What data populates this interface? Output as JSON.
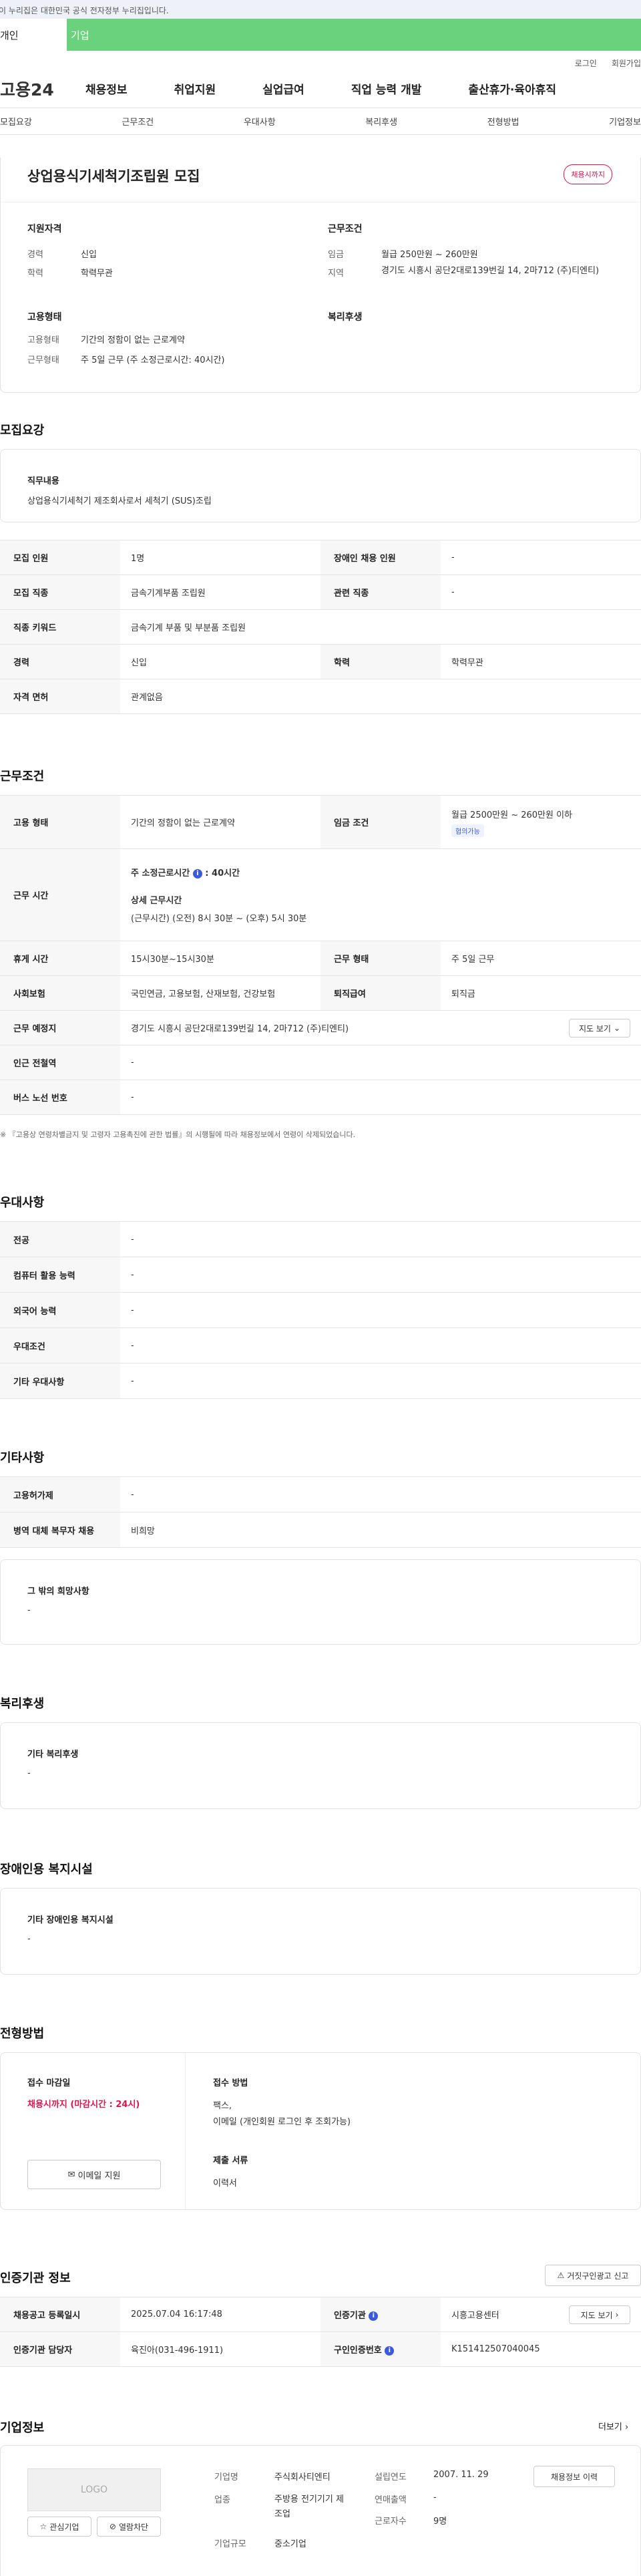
{
  "gov_banner": {
    "text": "이 누리집은 대한민국 공식 전자정부 누리집입니다."
  },
  "top_tabs": [
    {
      "label": "개인"
    },
    {
      "label": "기업"
    }
  ],
  "utility": {
    "login": "로그인",
    "join": "회원가입"
  },
  "gnb": {
    "logo": "고용24",
    "items": [
      "채용정보",
      "취업지원",
      "실업급여",
      "직업 능력 개발",
      "출산휴가·육아휴직"
    ]
  },
  "subnav": [
    "모집요강",
    "근무조건",
    "우대사항",
    "복리후생",
    "전형방법",
    "기업정보"
  ],
  "summary": {
    "title": "상업용식기세척기조립원 모집",
    "badge": "채용시까지",
    "qual_title": "지원자격",
    "career_label": "경력",
    "career_value": "신입",
    "edu_label": "학력",
    "edu_value": "학력무관",
    "cond_title": "근무조건",
    "wage_label": "임금",
    "wage_value": "월급 250만원 ~ 260만원",
    "area_label": "지역",
    "area_value": "경기도 시흥시 공단2대로139번길 14, 2마712 (주)티엔티)",
    "emp_title": "고용형태",
    "emptype_label": "고용형태",
    "emptype_value": "기간의 정함이 없는 근로계약",
    "worktype_label": "근무형태",
    "worktype_value": "주 5일 근무 (주 소정근로시간: 40시간)",
    "welfare_title": "복리후생"
  },
  "recruit": {
    "section_title": "모집요강",
    "duty_label": "직무내용",
    "duty_value": "상업용식기세척기 제조회사로서 세척기 (SUS)조립",
    "rows": {
      "headcount_h": "모집 인원",
      "headcount_v": "1명",
      "disabled_h": "장애인 채용 인원",
      "disabled_v": "-",
      "job_h": "모집 직종",
      "job_v": "금속기계부품 조립원",
      "related_h": "관련 직종",
      "related_v": "-",
      "keyword_h": "직종 키워드",
      "keyword_v": "금속기계 부품 및 부분품 조립원",
      "career_h": "경력",
      "career_v": "신입",
      "edu_h": "학력",
      "edu_v": "학력무관",
      "license_h": "자격 면허",
      "license_v": "관계없음"
    }
  },
  "work": {
    "section_title": "근무조건",
    "emp_h": "고용 형태",
    "emp_v": "기간의 정함이 없는 근로계약",
    "wage_h": "임금 조건",
    "wage_v": "월급 2500만원 ~ 260만원 이하",
    "wage_badge": "협의가능",
    "hours_h": "근무 시간",
    "hours_std_label": "주 소정근로시간",
    "hours_std_value": "40시간",
    "hours_detail_label": "상세 근무시간",
    "hours_detail_value": "(근무시간) (오전) 8시 30분 ~ (오후) 5시 30분",
    "rest_h": "휴게 시간",
    "rest_v": "15시30분~15시30분",
    "worktype_h": "근무 형태",
    "worktype_v": "주 5일 근무",
    "insurance_h": "사회보험",
    "insurance_v": "국민연금, 고용보험, 산재보험, 건강보험",
    "severance_h": "퇴직급여",
    "severance_v": "퇴직금",
    "place_h": "근무 예정지",
    "place_v": "경기도 시흥시 공단2대로139번길 14, 2마712 (주)티엔티)",
    "map_btn": "지도 보기",
    "station_h": "인근 전철역",
    "station_v": "-",
    "bus_h": "버스 노선 번호",
    "bus_v": "-",
    "note": "※ 『고용상 연령차별금지 및 고령자 고용촉진에 관한 법률』의 시행될에 따라 채용정보에서 연령이 삭제되었습니다."
  },
  "pref": {
    "section_title": "우대사항",
    "rows": [
      {
        "h": "전공",
        "v": "-"
      },
      {
        "h": "컴퓨터 활용 능력",
        "v": "-"
      },
      {
        "h": "외국어 능력",
        "v": "-"
      },
      {
        "h": "우대조건",
        "v": "-"
      },
      {
        "h": "기타 우대사항",
        "v": "-"
      }
    ]
  },
  "etc": {
    "section_title": "기타사항",
    "rows": [
      {
        "h": "고용허가제",
        "v": "-"
      },
      {
        "h": "병역 대체 복무자 채용",
        "v": "비희망"
      }
    ],
    "other_label": "그 밖의 희망사항",
    "other_value": "-"
  },
  "welfare": {
    "section_title": "복리후생",
    "label": "기타 복리후생",
    "value": "-"
  },
  "disability": {
    "section_title": "장애인용 복지시설",
    "label": "기타 장애인용 복지시설",
    "value": "-"
  },
  "selection": {
    "section_title": "전형방법",
    "deadline_label": "접수 마감일",
    "deadline_value": "채용시까지 (마감시간 : 24시)",
    "email_btn": "이메일 지원",
    "method_label": "접수 방법",
    "method_value1": "팩스,",
    "method_value2": "이메일 (개인회원 로그인 후 조회가능)",
    "docs_label": "제출 서류",
    "docs_value": "이력서"
  },
  "agency": {
    "section_title": "인증기관 정보",
    "report_btn": "거짓구인광고 신고",
    "reg_h": "채용공고 등록일시",
    "reg_v": "2025.07.04 16:17:48",
    "org_h": "인증기관",
    "org_v": "시흥고용센터",
    "map_btn": "지도 보기",
    "mgr_h": "인증기관 담당자",
    "mgr_v": "육진아(031-496-1911)",
    "no_h": "구인인증번호",
    "no_v": "K151412507040045"
  },
  "company": {
    "section_title": "기업정보",
    "more": "더보기",
    "logo": "LOGO",
    "fav_btn": "관심기업",
    "block_btn": "열람차단",
    "name_label": "기업명",
    "name_value": "주식회사티엔티",
    "biz_label": "업종",
    "biz_value": "주방용 전기기기 제조업",
    "size_label": "기업규모",
    "size_value": "중소기업",
    "est_label": "설립연도",
    "est_value": "2007. 11. 29",
    "sales_label": "연매출액",
    "sales_value": "-",
    "emp_label": "근로자수",
    "emp_value": "9명",
    "jobs_btn": "채용정보 이력"
  }
}
